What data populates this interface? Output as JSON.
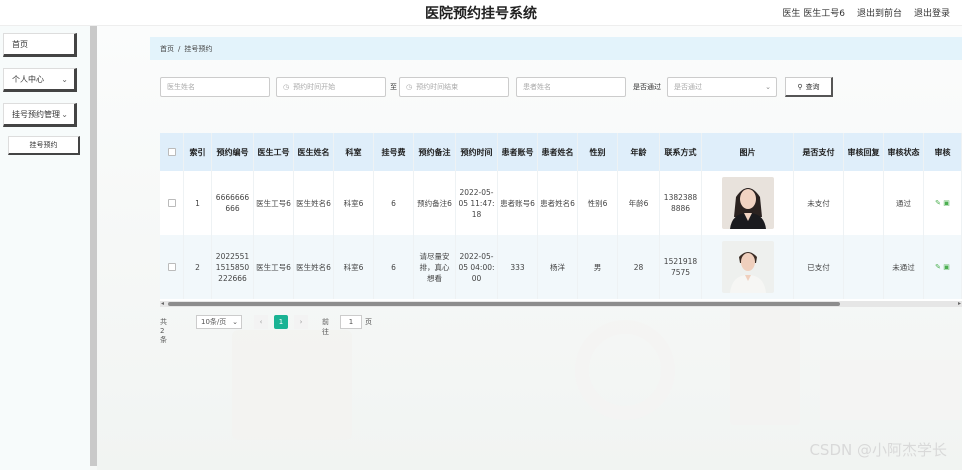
{
  "header": {
    "title": "医院预约挂号系统",
    "user_label": "医生 医生工号6",
    "back_label": "退出到前台",
    "logout_label": "退出登录"
  },
  "sidebar": {
    "items": [
      {
        "label": "首页"
      },
      {
        "label": "个人中心",
        "chevron": "chevron-down-icon"
      },
      {
        "label": "挂号预约管理",
        "chevron": "chevron-down-icon"
      }
    ],
    "sub_item": "挂号预约"
  },
  "breadcrumb": {
    "home": "首页",
    "sep": "/",
    "current": "挂号预约"
  },
  "search": {
    "doctor_name_placeholder": "医生姓名",
    "start_time_placeholder": "预约时间开始",
    "to_label": "至",
    "end_time_placeholder": "预约时间结束",
    "patient_name_placeholder": "患者姓名",
    "paid_label": "是否通过",
    "paid_placeholder": "是否通过",
    "search_button": "查询"
  },
  "table": {
    "headers": [
      "索引",
      "预约编号",
      "医生工号",
      "医生姓名",
      "科室",
      "挂号费",
      "预约备注",
      "预约时间",
      "患者账号",
      "患者姓名",
      "性别",
      "年龄",
      "联系方式",
      "图片",
      "是否支付",
      "审核回复",
      "审核状态",
      "审核"
    ],
    "rows": [
      {
        "idx": "1",
        "no": "6666666666",
        "doc_id": "医生工号6",
        "doc_name": "医生姓名6",
        "dept": "科室6",
        "fee": "6",
        "note": "预约备注6",
        "time": "2022-05-05 11:47:18",
        "acc": "患者账号6",
        "pname": "患者姓名6",
        "sex": "性别6",
        "age": "年龄6",
        "phone": "13823888886",
        "paid": "未支付",
        "reply": "",
        "status": "通过"
      },
      {
        "idx": "2",
        "no": "20225511515850222666",
        "doc_id": "医生工号6",
        "doc_name": "医生姓名6",
        "dept": "科室6",
        "fee": "6",
        "note": "请尽量安排，真心想看",
        "time": "2022-05-05 04:00:00",
        "acc": "333",
        "pname": "杨洋",
        "sex": "男",
        "age": "28",
        "phone": "15219187575",
        "paid": "已支付",
        "reply": "",
        "status": "未通过"
      }
    ]
  },
  "pagination": {
    "total": "共 2 条",
    "page_size": "10条/页",
    "current_page": "1",
    "goto_label": "前往",
    "goto_value": "1",
    "page_label": "页"
  },
  "watermark": "CSDN @小阿杰学长"
}
